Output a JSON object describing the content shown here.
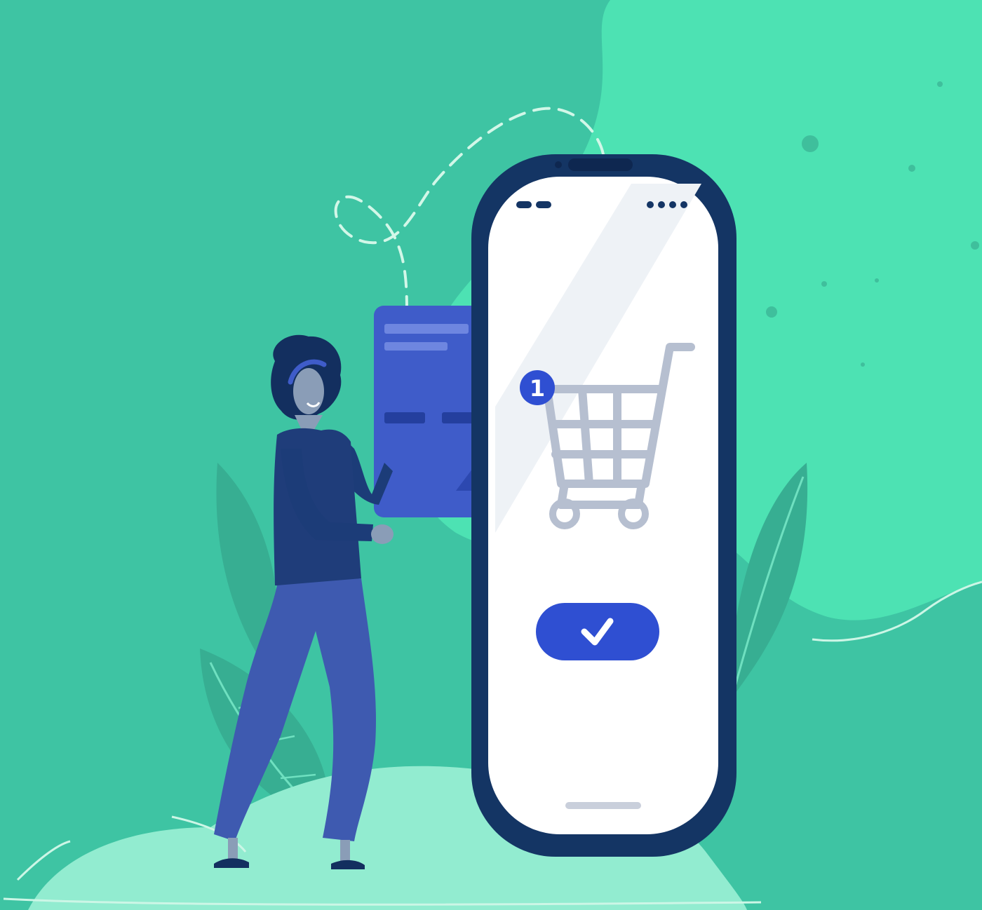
{
  "cart": {
    "item_count": "1"
  },
  "icons": {
    "cart": "shopping-cart-icon",
    "confirm": "checkmark-icon"
  },
  "colors": {
    "background": "#3ec4a3",
    "light_blob": "#4de2b3",
    "phone_frame": "#143564",
    "phone_screen": "#ffffff",
    "accent_blue": "#2f4fd2",
    "cart_gray": "#b6bfd0"
  }
}
